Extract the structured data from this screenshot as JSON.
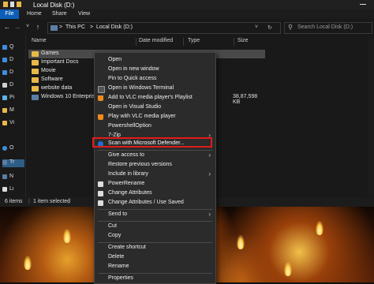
{
  "titlebar": {
    "title": "Local Disk (D:)"
  },
  "ribbon": {
    "tabs": [
      "File",
      "Home",
      "Share",
      "View"
    ]
  },
  "address": {
    "crumbs": [
      "This PC",
      "Local Disk (D:)"
    ],
    "separator": ">"
  },
  "search": {
    "placeholder": "Search Local Disk (D:)"
  },
  "sidebar": {
    "items": [
      "Q",
      "D",
      "D",
      "D",
      "Pi",
      "M",
      "Vi",
      "O",
      "Tr",
      "N",
      "Li"
    ]
  },
  "columns": {
    "name": "Name",
    "date": "Date modified",
    "type": "Type",
    "size": "Size"
  },
  "files": [
    {
      "name": "Games",
      "date": "",
      "size": "",
      "kind": "folder",
      "selected": true
    },
    {
      "name": "Important Docs",
      "date": "",
      "size": "",
      "kind": "folder",
      "selected": false
    },
    {
      "name": "Movie",
      "date": "",
      "size": "",
      "kind": "folder",
      "selected": false
    },
    {
      "name": "Software",
      "date": "",
      "size": "",
      "kind": "folder",
      "selected": false
    },
    {
      "name": "website data",
      "date": "",
      "size": "",
      "kind": "folder",
      "selected": false
    },
    {
      "name": "Windows 10 Enterprise 1",
      "date": "",
      "size": "38,87,598 KB",
      "kind": "file",
      "selected": false
    }
  ],
  "status": {
    "count": "6 items",
    "selected": "1 item selected"
  },
  "context_menu": {
    "items": [
      {
        "label": "Open"
      },
      {
        "label": "Open in new window"
      },
      {
        "label": "Pin to Quick access"
      },
      {
        "label": "Open in Windows Terminal"
      },
      {
        "label": "Add to VLC media player's Playlist"
      },
      {
        "label": "Open in Visual Studio"
      },
      {
        "label": "Play with VLC media player"
      },
      {
        "label": "PowershellOption"
      },
      {
        "label": "7-Zip"
      },
      {
        "label": "Scan with Microsoft Defender..."
      },
      {
        "label": "Give access to"
      },
      {
        "label": "Restore previous versions"
      },
      {
        "label": "Include in library"
      },
      {
        "label": "PowerRename"
      },
      {
        "label": "Change Attributes"
      },
      {
        "label": "Change Attributes / Use Saved"
      },
      {
        "label": "Send to"
      },
      {
        "label": "Cut"
      },
      {
        "label": "Copy"
      },
      {
        "label": "Create shortcut"
      },
      {
        "label": "Delete"
      },
      {
        "label": "Rename"
      },
      {
        "label": "Properties"
      }
    ],
    "highlighted": "Scan with Microsoft Defender...",
    "highlight_color": "#e11b1b"
  },
  "colors": {
    "accent": "#0d5eb6",
    "folder": "#e8b94a",
    "menu_bg": "#2b2b2b"
  }
}
